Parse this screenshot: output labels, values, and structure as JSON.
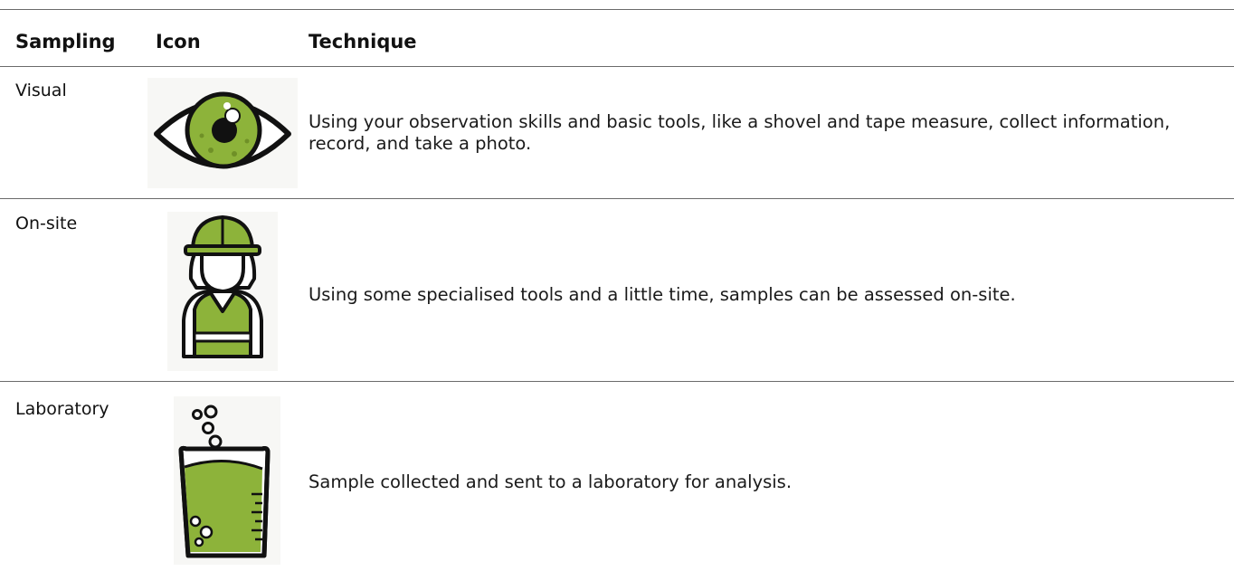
{
  "table": {
    "headers": {
      "sampling": "Sampling",
      "icon": "Icon",
      "technique": "Technique"
    },
    "rows": [
      {
        "label": "Visual",
        "icon": "eye-icon",
        "description": "Using your observation skills and basic tools, like a shovel and tape measure, collect information, record, and take a photo."
      },
      {
        "label": "On-site",
        "icon": "worker-icon",
        "description": "Using some specialised tools and a little time, samples can be assessed on-site."
      },
      {
        "label": "Laboratory",
        "icon": "beaker-icon",
        "description": "Sample collected and sent to a laboratory for analysis."
      }
    ]
  },
  "colors": {
    "accent_green": "#8db33a",
    "rule": "#6b6b6b",
    "text": "#111111"
  }
}
